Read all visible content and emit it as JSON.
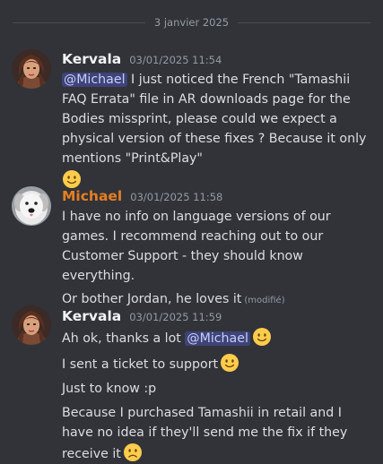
{
  "divider": {
    "date": "3 janvier 2025"
  },
  "messages": [
    {
      "author": "Kervala",
      "timestamp": "03/01/2025 11:54",
      "mention": "@Michael",
      "text": " I just noticed the French \"Tamashii FAQ Errata\" file in AR downloads page for the Bodies missprint, please could we expect a physical version of these fixes ? Because it only mentions \"Print&Play\"",
      "emoji": "slightly-smiling-face"
    },
    {
      "author": "Michael",
      "timestamp": "03/01/2025 11:58",
      "text": "I have no info on language versions of our games. I recommend reaching out to our Customer Support - they should know everything.",
      "followup": "Or bother Jordan, he loves it",
      "edited": "(modifié)"
    },
    {
      "author": "Kervala",
      "timestamp": "03/01/2025 11:59",
      "line1_text": "Ah ok, thanks a lot ",
      "line1_mention": "@Michael",
      "line2_text": "I sent a ticket to support",
      "line3_text": "Just to know :p",
      "line4_text": "Because I purchased Tamashii in retail and I have no idea if they'll send me the fix if they receive it"
    }
  ],
  "colors": {
    "background": "#313338",
    "michael_name": "#e67e22",
    "mention_bg": "#5865f2"
  }
}
